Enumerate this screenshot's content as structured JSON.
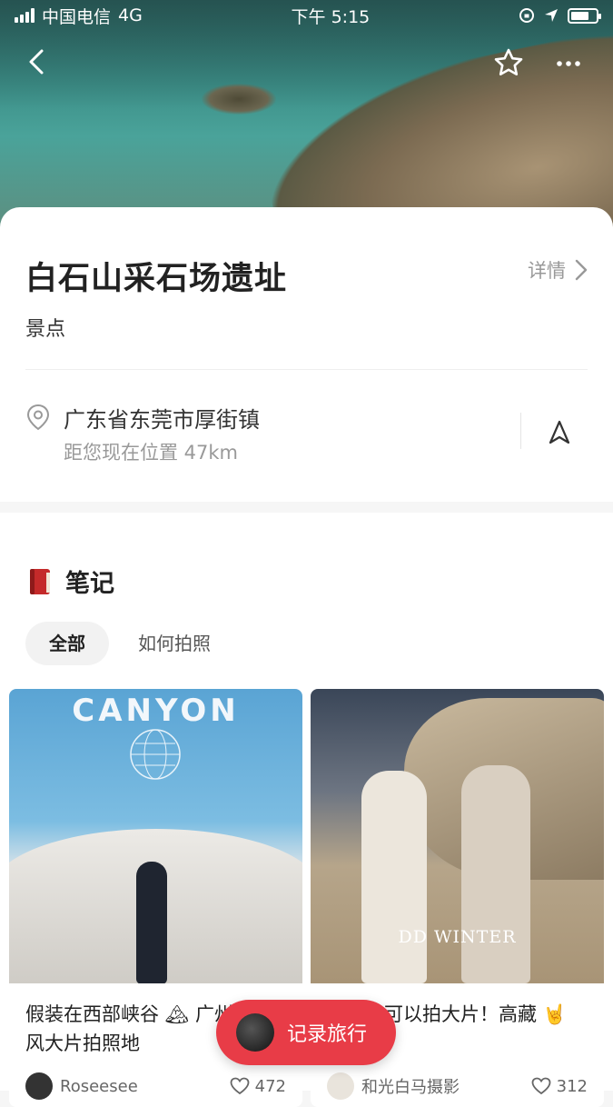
{
  "status_bar": {
    "carrier": "中国电信",
    "network": "4G",
    "time": "下午 5:15"
  },
  "place": {
    "title": "白石山采石场遗址",
    "detail_label": "详情",
    "category": "景点",
    "address": "广东省东莞市厚街镇",
    "distance": "距您现在位置 47km"
  },
  "notes": {
    "section_title": "笔记",
    "tabs": [
      {
        "label": "全部"
      },
      {
        "label": "如何拍照"
      }
    ],
    "items": [
      {
        "image_text": "CANYON",
        "caption": "假装在西部峡谷 🏔 广州 INS 风大片拍照地",
        "author": "Roseesee",
        "likes": "472"
      },
      {
        "image_text": "DD WINTER",
        "caption": "石场也可以拍大片！高藏 🤘",
        "author": "和光白马摄影",
        "likes": "312"
      }
    ]
  },
  "fab": {
    "label": "记录旅行"
  }
}
